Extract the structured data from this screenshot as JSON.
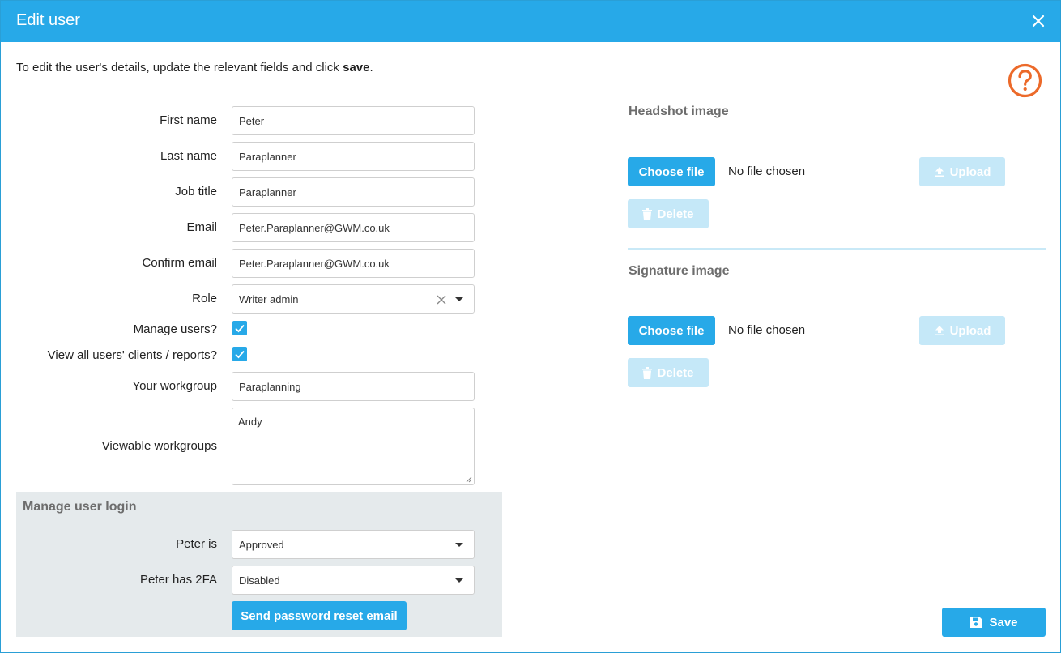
{
  "dialog": {
    "title": "Edit user",
    "intro_prefix": "To edit the user's details, update the relevant fields and click ",
    "intro_bold": "save",
    "intro_suffix": "."
  },
  "form": {
    "first_name": {
      "label": "First name",
      "value": "Peter"
    },
    "last_name": {
      "label": "Last name",
      "value": "Paraplanner"
    },
    "job_title": {
      "label": "Job title",
      "value": "Paraplanner"
    },
    "email": {
      "label": "Email",
      "value": "Peter.Paraplanner@GWM.co.uk"
    },
    "confirm_email": {
      "label": "Confirm email",
      "value": "Peter.Paraplanner@GWM.co.uk"
    },
    "role": {
      "label": "Role",
      "value": "Writer admin"
    },
    "manage_users": {
      "label": "Manage users?",
      "checked": true
    },
    "view_all": {
      "label": "View all users' clients / reports?",
      "checked": true
    },
    "workgroup": {
      "label": "Your workgroup",
      "value": "Paraplanning"
    },
    "viewable": {
      "label": "Viewable workgroups",
      "value": "Andy"
    }
  },
  "login": {
    "title": "Manage user login",
    "status_label": "Peter is",
    "status_value": "Approved",
    "twofa_label": "Peter has 2FA",
    "twofa_value": "Disabled",
    "reset_button": "Send password reset email"
  },
  "headshot": {
    "title": "Headshot image",
    "choose": "Choose file",
    "no_file": "No file chosen",
    "upload": "Upload",
    "delete": "Delete"
  },
  "signature": {
    "title": "Signature image",
    "choose": "Choose file",
    "no_file": "No file chosen",
    "upload": "Upload",
    "delete": "Delete"
  },
  "footer": {
    "save": "Save"
  },
  "colors": {
    "accent": "#27a9e8",
    "help": "#ec6a2a",
    "panel": "#e5eaec",
    "disabled": "#c5e8f8"
  }
}
